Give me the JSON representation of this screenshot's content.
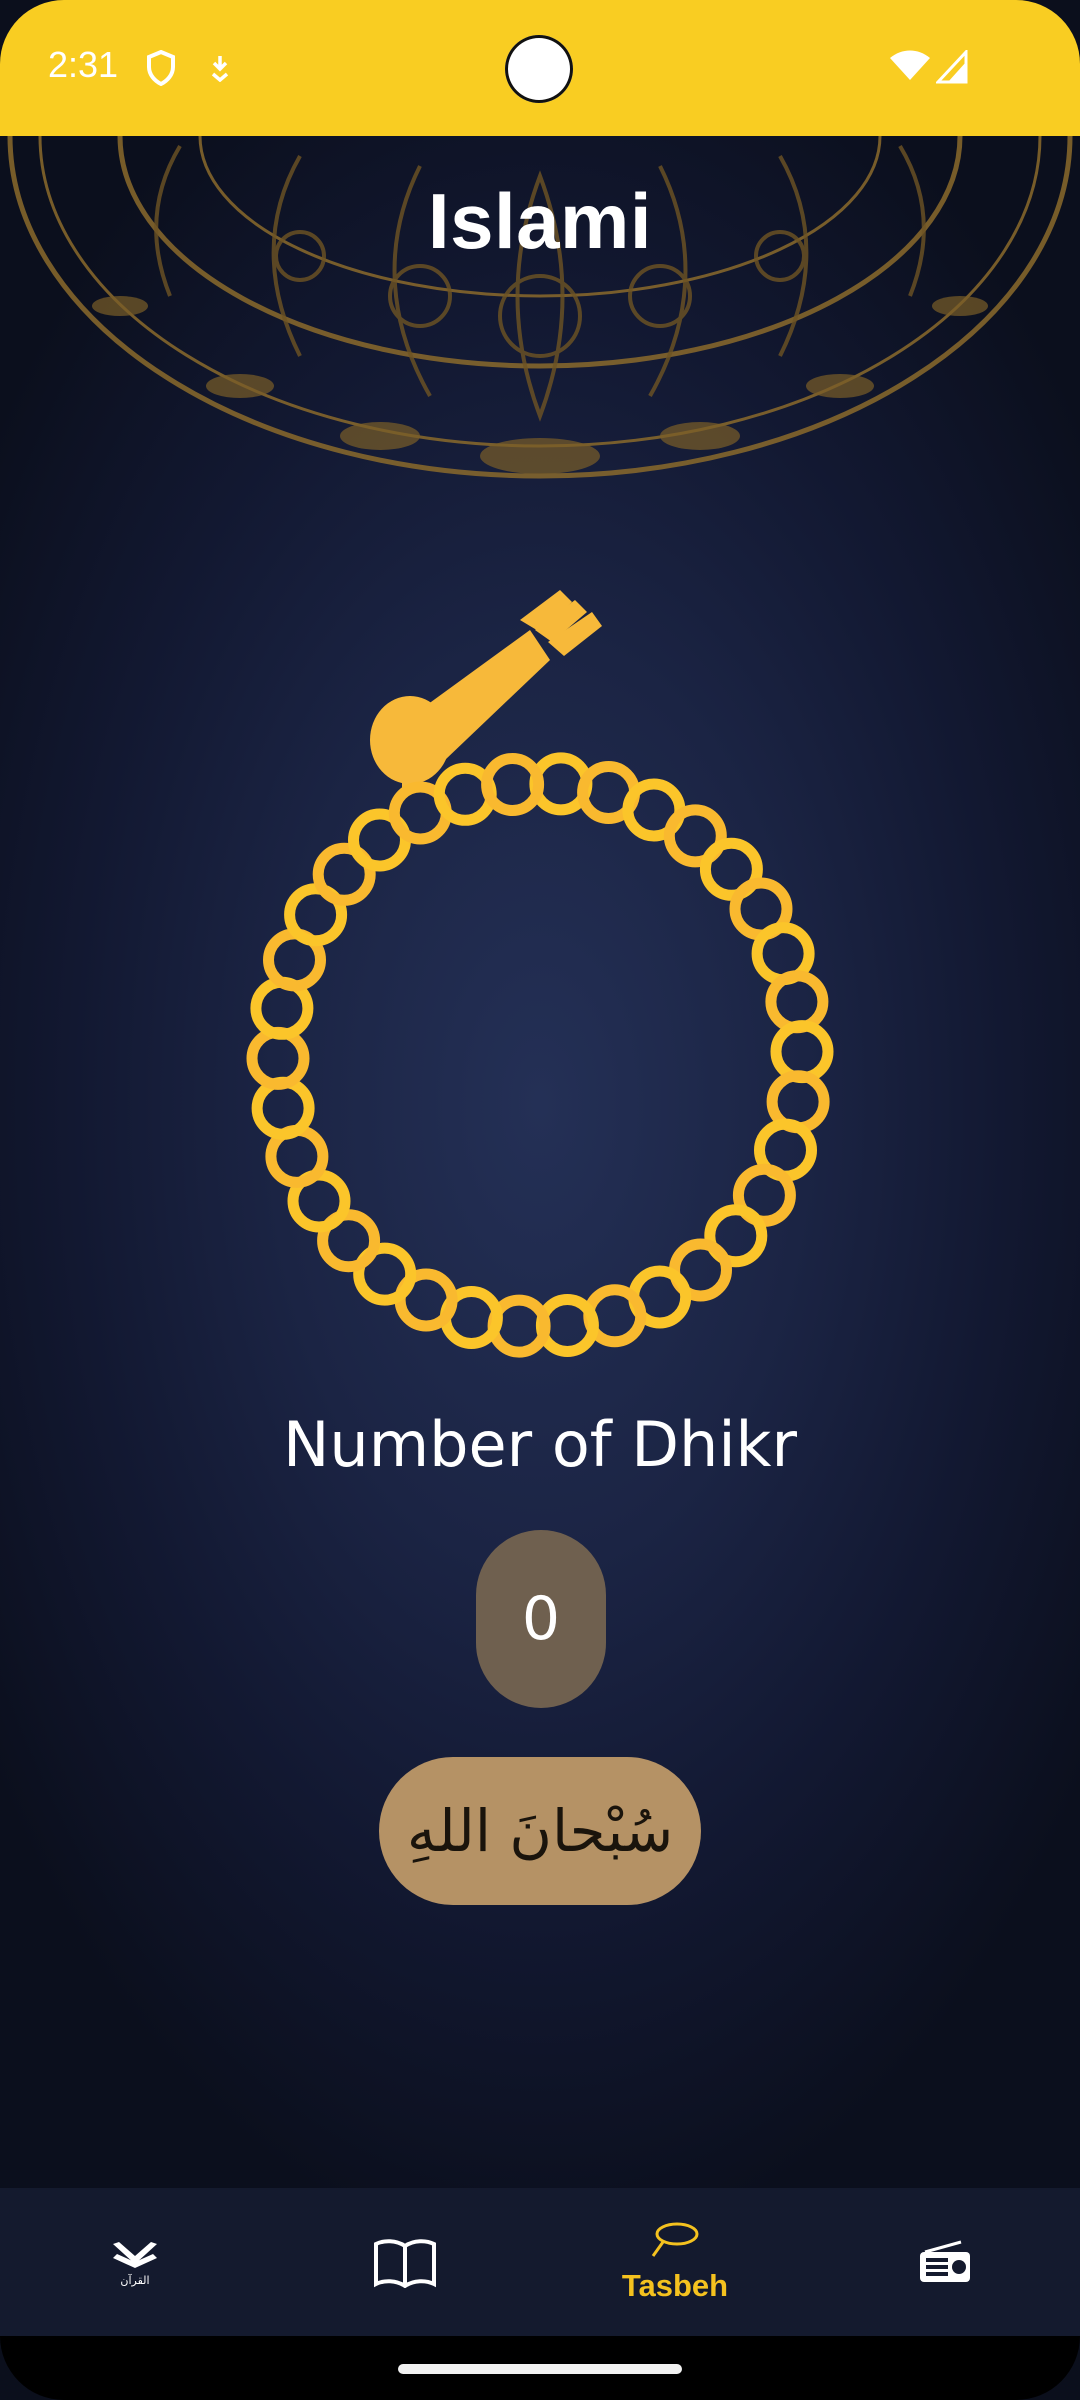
{
  "status_bar": {
    "time": "2:31",
    "icons": [
      "shield-icon",
      "download-icon",
      "wifi-icon",
      "cell-signal-icon"
    ],
    "background": "#f9cd22"
  },
  "header": {
    "title": "Islami"
  },
  "tasbeh": {
    "label": "Number of Dhikr",
    "count": "0",
    "dhikr_text": "سُبْحانَ اللهِ"
  },
  "bottom_nav": {
    "items": [
      {
        "name": "quran",
        "icon": "quran-icon",
        "label": "القرآن"
      },
      {
        "name": "hadith",
        "icon": "book-icon",
        "label": ""
      },
      {
        "name": "tasbeh",
        "icon": "tasbeh-icon",
        "label": "Tasbeh",
        "active": true
      },
      {
        "name": "radio",
        "icon": "radio-icon",
        "label": ""
      }
    ]
  },
  "colors": {
    "accent": "#f5c21f",
    "counter_bg": "#6f604f",
    "button_bg": "#b59265",
    "nav_bg": "#141a2e"
  }
}
